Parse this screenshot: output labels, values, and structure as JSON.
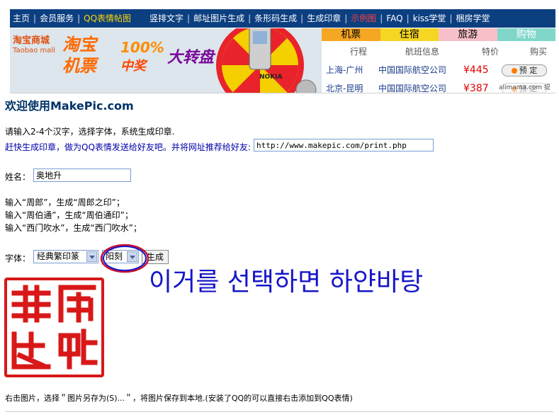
{
  "nav": {
    "items": [
      {
        "label": "主页"
      },
      {
        "label": "会员服务"
      },
      {
        "label": "QQ表情帖图"
      },
      {
        "label": "竖排文字"
      },
      {
        "label": "邮址图片生成"
      },
      {
        "label": "条形码生成"
      },
      {
        "label": "生成印章"
      },
      {
        "label": "示例图"
      },
      {
        "label": "FAQ"
      },
      {
        "label": "kiss学堂"
      },
      {
        "label": "梱房学堂"
      }
    ]
  },
  "banner": {
    "logo_cn": "淘宝商城",
    "logo_en": "Taobao mall",
    "title_line1": "淘宝",
    "title_line2": "机票",
    "percent": "100%",
    "prize": "中奖",
    "bigwheel": "大转盘",
    "phone_label": "NOKIA",
    "tabs": [
      {
        "label": "机票",
        "color": "#f5a623"
      },
      {
        "label": "住宿",
        "color": "#f5d623"
      },
      {
        "label": "旅游",
        "color": "#f7c0c8"
      },
      {
        "label": "购物",
        "color": "#7fd6c9"
      }
    ],
    "columns": [
      "行程",
      "航班信息",
      "特价",
      "购买"
    ],
    "rows": [
      {
        "route": "上海-广州",
        "airline": "中国国际航空公司",
        "price": "¥445",
        "button": "预 定"
      },
      {
        "route": "北京-昆明",
        "airline": "中国国际航空公司",
        "price": "¥387",
        "button": "预 定"
      }
    ],
    "watermark": "alimama.com 提供"
  },
  "main": {
    "welcome": "欢迎使用MakePic.com",
    "instruction": "请输入2-4个汉字，选择字体，系统生成印章.",
    "share_text": "赶快生成印章，做为QQ表情发送给好友吧。并将网址推荐给好友:",
    "share_url": "http://www.makepic.com/print.php",
    "name_label": "姓名：",
    "name_value": "奥地升",
    "examples": [
      "输入“周郎”，生成“周郎之印”；",
      "输入“周伯通”，生成“周伯通印”；",
      "输入“西门吹水”，生成“西门吹水”；"
    ],
    "font_label": "字体：",
    "font_value": "经典繁印篆",
    "style_value": "阳刻",
    "generate_label": "生成",
    "annotation": "이거를 선택하면 하얀바탕",
    "footer_note": "右击图片，选择＂图片另存为(S)...＂，将图片保存到本地.(安装了QQ的可以直接右击添加到QQ表情)"
  },
  "colors": {
    "nav_bg": "#0c3f80",
    "seal_red": "#d81818",
    "annotation": "#1515c8",
    "circle": "#c8102e"
  }
}
